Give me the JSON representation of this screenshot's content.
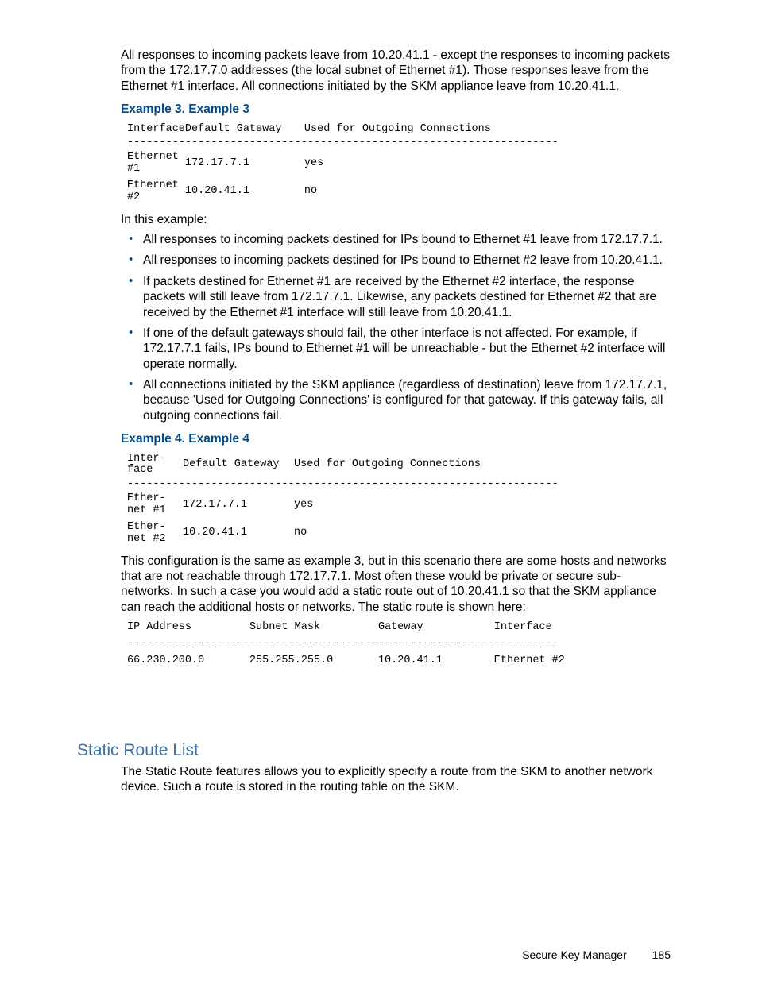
{
  "intro_para": "All responses to incoming packets leave from 10.20.41.1 - except the responses to incoming packets from the 172.17.7.0 addresses (the local subnet of Ethernet #1). Those responses leave from the Ethernet #1 interface. All connections initiated by the SKM appliance leave from 10.20.41.1.",
  "example3": {
    "heading": "Example 3. Example 3",
    "header": {
      "col1a": "Interface",
      "col1b": "",
      "col2": "Default Gateway",
      "col3": "Used for Outgoing Connections"
    },
    "sep": "-------------------------------------------------------------------",
    "rows": [
      {
        "iface_l1": "Ethernet",
        "iface_l2": "#1",
        "gw": "172.17.7.1",
        "out": "yes"
      },
      {
        "iface_l1": "Ethernet",
        "iface_l2": "#2",
        "gw": "10.20.41.1",
        "out": "no"
      }
    ],
    "after_label": "In this example:",
    "bullets": [
      "All responses to incoming packets destined for IPs bound to Ethernet #1 leave from 172.17.7.1.",
      "All responses to incoming packets destined for IPs bound to Ethernet #2 leave from 10.20.41.1.",
      "If packets destined for Ethernet #1 are received by the Ethernet #2 interface, the response packets will still leave from 172.17.7.1. Likewise, any packets destined for Ethernet #2 that are received by the Ethernet #1 interface will still leave from 10.20.41.1.",
      "If one of the default gateways should fail, the other interface is not affected. For example, if 172.17.7.1 fails, IPs bound to Ethernet #1 will be unreachable - but the Ethernet #2 interface will operate normally.",
      "All connections initiated by the SKM appliance (regardless of destination) leave from 172.17.7.1, because 'Used for Outgoing Connections' is configured for that gateway. If this gateway fails, all outgoing connections fail."
    ]
  },
  "example4": {
    "heading": "Example 4. Example 4",
    "header": {
      "col1a": "Inter-",
      "col1b": "face",
      "col2": "Default Gateway",
      "col3": "Used for Outgoing Connections"
    },
    "sep": "-------------------------------------------------------------------",
    "rows": [
      {
        "iface_l1": "Ether-",
        "iface_l2": "net #1",
        "gw": "172.17.7.1",
        "out": "yes"
      },
      {
        "iface_l1": "Ether-",
        "iface_l2": "net #2",
        "gw": "10.20.41.1",
        "out": "no"
      }
    ],
    "after_para": "This configuration is the same as example 3, but in this scenario there are some hosts and networks that are not reachable through 172.17.7.1. Most often these would be private or secure sub-networks. In such a case you would add a static route out of 10.20.41.1 so that the SKM appliance can reach the additional hosts or networks. The static route is shown here:",
    "route_block": "IP Address         Subnet Mask         Gateway           Interface\n-------------------------------------------------------------------\n66.230.200.0       255.255.255.0       10.20.41.1        Ethernet #2"
  },
  "static_route": {
    "heading": "Static Route List",
    "para": "The Static Route features allows you to explicitly specify a route from the SKM to another network device. Such a route is stored in the routing table on the SKM."
  },
  "footer": {
    "label": "Secure Key Manager",
    "page": "185"
  }
}
